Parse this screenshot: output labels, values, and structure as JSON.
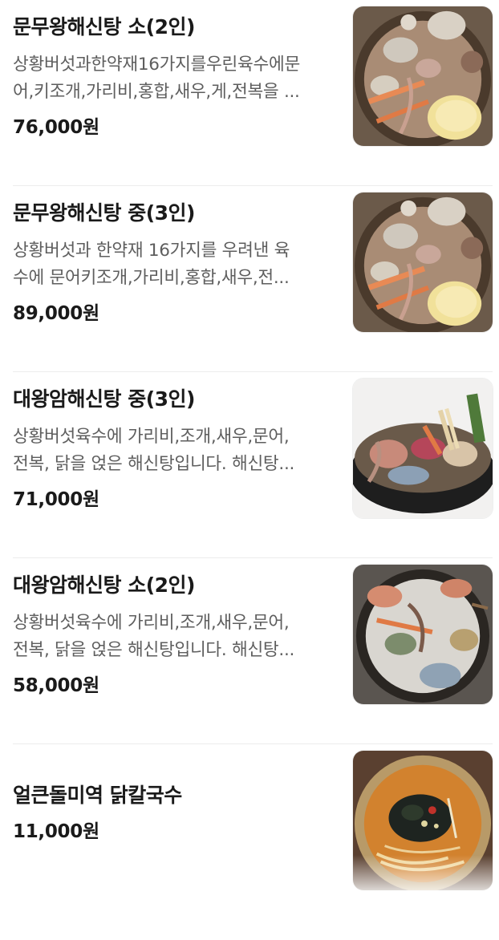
{
  "menu": {
    "items": [
      {
        "name": "문무왕해신탕 소(2인)",
        "description_lines": [
          "상황버섯과한약재16가지를우린육수에문",
          "어,키조개,가리비,홍합,새우,게,전복을 ..."
        ],
        "price": "76,000원",
        "photo_icon": "seafood-hotpot-photo"
      },
      {
        "name": "문무왕해신탕 중(3인)",
        "description_lines": [
          "상황버섯과 한약재 16가지를 우려낸 육",
          "수에 문어키조개,가리비,홍합,새우,전..."
        ],
        "price": "89,000원",
        "photo_icon": "seafood-hotpot-photo"
      },
      {
        "name": "대왕암해신탕 중(3인)",
        "description_lines": [
          "상황버섯육수에 가리비,조개,새우,문어,",
          "전복, 닭을 얹은 해신탕입니다. 해신탕..."
        ],
        "price": "71,000원",
        "photo_icon": "seafood-hotpot-photo"
      },
      {
        "name": "대왕암해신탕 소(2인)",
        "description_lines": [
          "상황버섯육수에 가리비,조개,새우,문어,",
          "전복, 닭을 얹은 해신탕입니다. 해신탕..."
        ],
        "price": "58,000원",
        "photo_icon": "seafood-hotpot-photo"
      },
      {
        "name": "얼큰돌미역 닭칼국수",
        "description_lines": [],
        "price": "11,000원",
        "photo_icon": "noodle-soup-photo"
      }
    ]
  },
  "colors": {
    "text_primary": "#1a1a1a",
    "text_secondary": "#5e5e5e",
    "divider": "#ececec"
  }
}
